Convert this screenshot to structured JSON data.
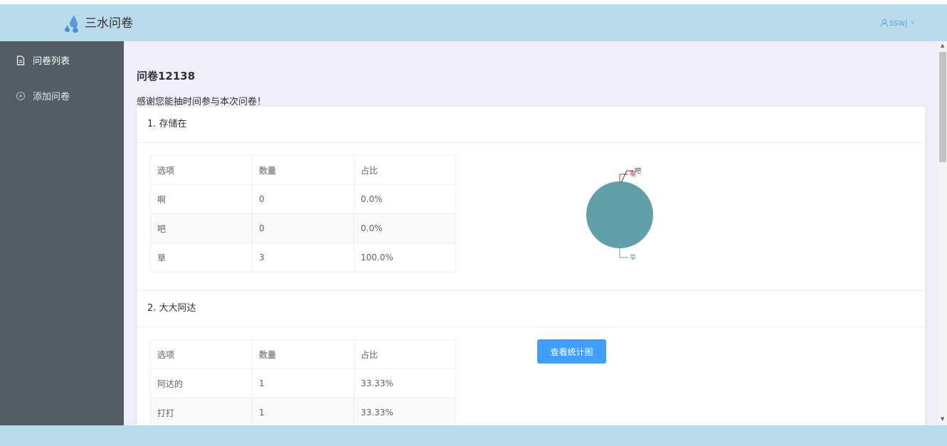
{
  "app": {
    "name": "三水问卷",
    "user": "sswj"
  },
  "sidebar": {
    "items": [
      {
        "label": "问卷列表"
      },
      {
        "label": "添加问卷"
      }
    ]
  },
  "survey": {
    "title": "问卷12138",
    "description": "感谢您能抽时间参与本次问卷！"
  },
  "table_headers": [
    "选项",
    "数量",
    "占比"
  ],
  "questions": [
    {
      "title": "1. 存储在",
      "rows": [
        {
          "option": "啊",
          "count": "0",
          "percent": "0.0%"
        },
        {
          "option": "吧",
          "count": "0",
          "percent": "0.0%"
        },
        {
          "option": "草",
          "count": "3",
          "percent": "100.0%"
        }
      ]
    },
    {
      "title": "2. 大大阿达",
      "button_label": "查看统计图",
      "rows": [
        {
          "option": "阿达的",
          "count": "1",
          "percent": "33.33%"
        },
        {
          "option": "打打",
          "count": "1",
          "percent": "33.33%"
        }
      ]
    }
  ],
  "chart_data": {
    "type": "pie",
    "categories": [
      "啊",
      "吧",
      "草"
    ],
    "values": [
      0,
      0,
      3
    ],
    "colors": [
      "#c23531",
      "#2f4554",
      "#61a0a8"
    ]
  }
}
